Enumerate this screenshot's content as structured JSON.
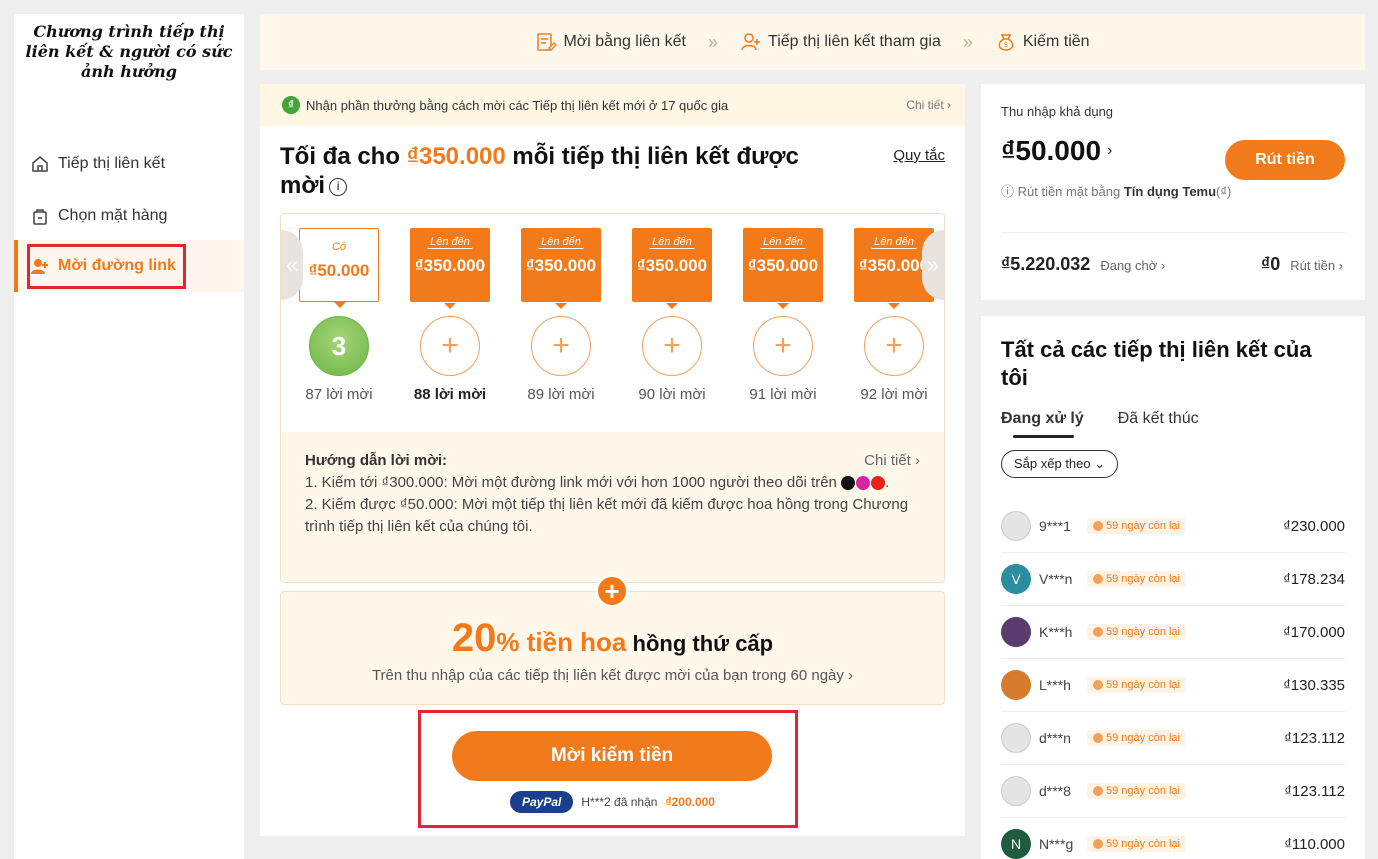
{
  "brand": "Chương trình tiếp thị liên kết & người có sức ảnh hưởng",
  "nav": [
    {
      "label": "Tiếp thị liên kết",
      "icon": "home-icon"
    },
    {
      "label": "Chọn mặt hàng",
      "icon": "bag-icon"
    },
    {
      "label": "Mời đường link",
      "icon": "user-plus-icon"
    }
  ],
  "steps": [
    "Mời bằng liên kết",
    "Tiếp thị liên kết tham gia",
    "Kiếm tiền"
  ],
  "banner": {
    "text": "Nhận phần thưởng bằng cách mời các Tiếp thị liên kết mới ở 17 quốc gia",
    "detail": "Chi tiết ›"
  },
  "headline": {
    "prefix": "Tối đa cho ",
    "amount": "₫350.000",
    "suffix": " mỗi tiếp thị liên kết được mời"
  },
  "rules": "Quy tắc",
  "tiers": [
    {
      "tag": "Có",
      "value": "₫50.000",
      "count": "3",
      "label": "87 lời mời"
    },
    {
      "tag": "Lên đến",
      "value": "₫350.000",
      "count": "+",
      "label": "88 lời mời"
    },
    {
      "tag": "Lên đến",
      "value": "₫350.000",
      "count": "+",
      "label": "89 lời mời"
    },
    {
      "tag": "Lên đến",
      "value": "₫350.000",
      "count": "+",
      "label": "90 lời mời"
    },
    {
      "tag": "Lên đến",
      "value": "₫350.000",
      "count": "+",
      "label": "91 lời mời"
    },
    {
      "tag": "Lên đến",
      "value": "₫350.000",
      "count": "+",
      "label": "92 lời mời"
    }
  ],
  "guide": {
    "title": "Hướng dẫn lời mời:",
    "detail": "Chi tiết ›",
    "line1": "1. Kiếm tới ₫300.000: Mời một đường link mới với hơn 1000 người theo dõi trên",
    "line2": "2. Kiếm được ₫50.000: Mời một tiếp thị liên kết mới đã kiếm được hoa hồng trong Chương trình tiếp thị liên kết của chúng tôi."
  },
  "commission": {
    "pct": "20",
    "unit": "%",
    "orange": " tiền hoa",
    "black": " hồng thứ cấp",
    "sub": "Trên thu nhập của các tiếp thị liên kết được mời của bạn trong 60 ngày ›"
  },
  "invite_button": "Mời kiếm tiền",
  "paypal": {
    "logo": "PayPal",
    "text": "H***2 đã nhận",
    "amount": "₫200.000"
  },
  "balance": {
    "label": "Thu nhập khả dụng",
    "amount": "₫50.000",
    "withdraw": "Rút tiền",
    "note_prefix": "ⓘ Rút tiền mặt bằng",
    "note_bold": "Tín dụng Temu",
    "note_suffix": "(₫)",
    "pending_value": "₫5.220.032",
    "pending_label": "Đang chờ ›",
    "out_value": "₫0",
    "out_label": "Rút tiền ›"
  },
  "affiliates": {
    "title": "Tất cả các tiếp thị liên kết của tôi",
    "tab_active": "Đang xử lý",
    "tab_other": "Đã kết thúc",
    "sort": "Sắp xếp theo ⌄",
    "rows": [
      {
        "initial": "",
        "name": "9***1",
        "days": "59 ngày còn lại",
        "amount": "₫230.000",
        "color": "#e4e4e4"
      },
      {
        "initial": "V",
        "name": "V***n",
        "days": "59 ngày còn lại",
        "amount": "₫178.234",
        "color": "#2b8da0"
      },
      {
        "initial": "",
        "name": "K***h",
        "days": "59 ngày còn lại",
        "amount": "₫170.000",
        "color": "#5a3d6e"
      },
      {
        "initial": "",
        "name": "L***h",
        "days": "59 ngày còn lại",
        "amount": "₫130.335",
        "color": "#d77b2e"
      },
      {
        "initial": "",
        "name": "d***n",
        "days": "59 ngày còn lại",
        "amount": "₫123.112",
        "color": "#e4e4e4"
      },
      {
        "initial": "",
        "name": "d***8",
        "days": "59 ngày còn lại",
        "amount": "₫123.112",
        "color": "#e4e4e4"
      },
      {
        "initial": "N",
        "name": "N***g",
        "days": "59 ngày còn lại",
        "amount": "₫110.000",
        "color": "#1f5c3d"
      }
    ]
  },
  "colors": {
    "accent": "#f27a1a",
    "highlight_box": "#e0262e"
  }
}
